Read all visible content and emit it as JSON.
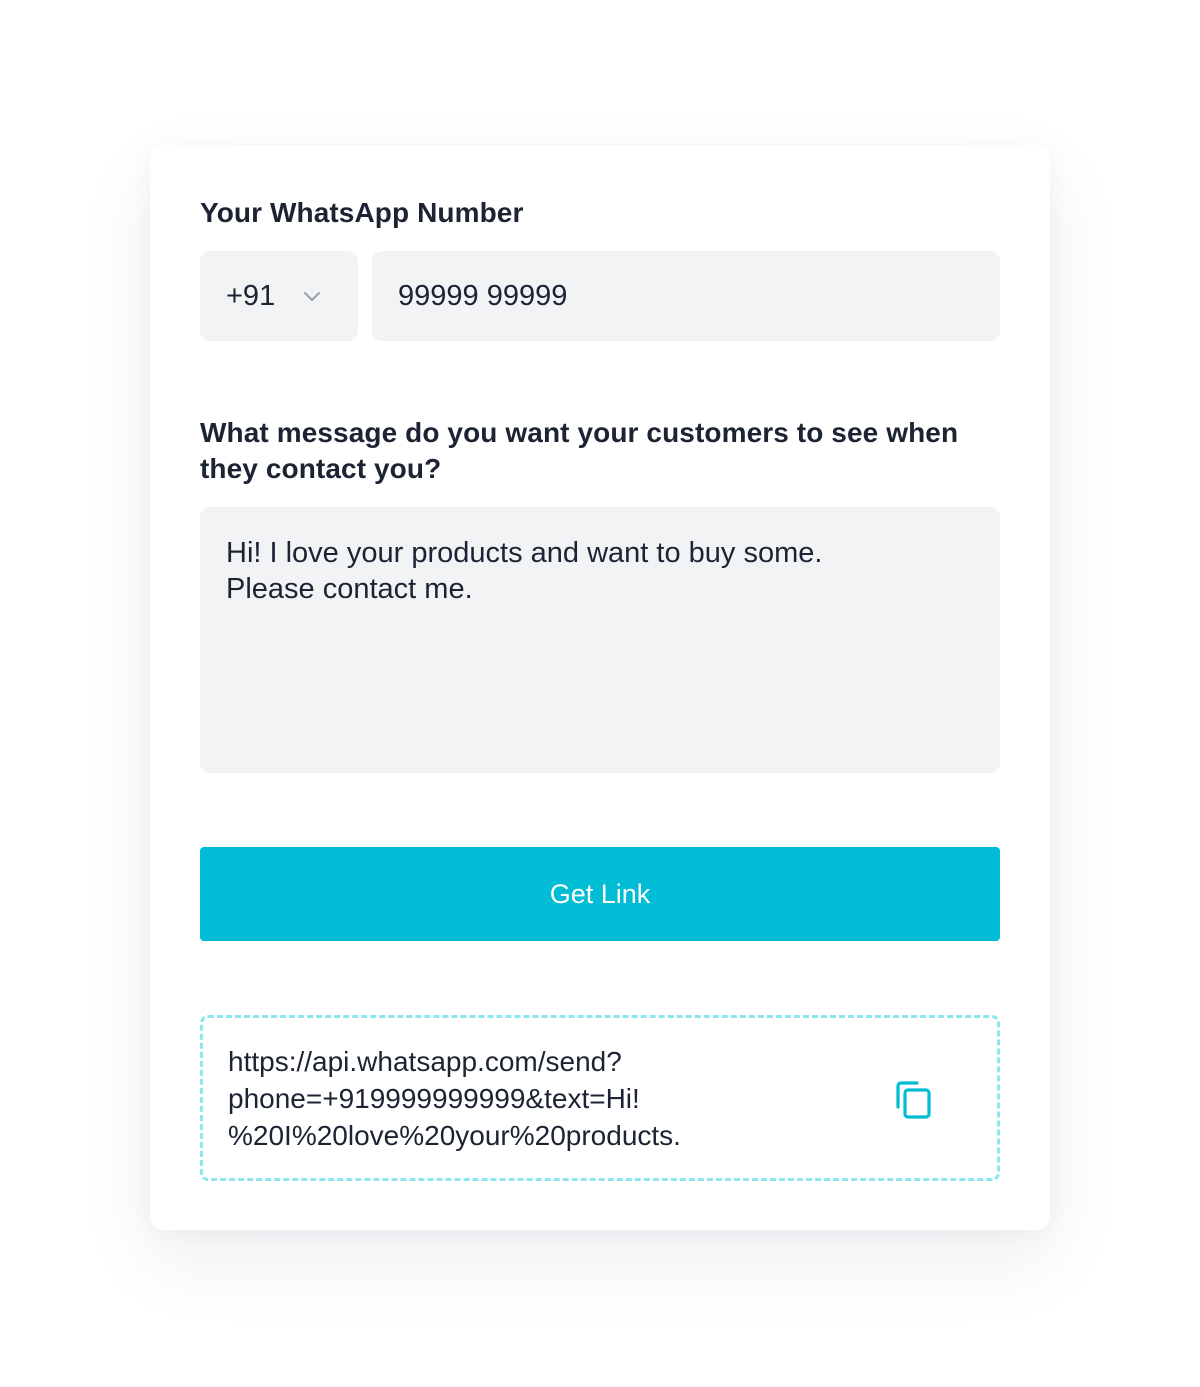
{
  "form": {
    "number_label": "Your WhatsApp Number",
    "country_code": "+91",
    "phone_value": "99999 99999",
    "message_label": "What message do you want your customers to see when they contact you?",
    "message_value": "Hi! I love your products and want to buy some.\nPlease contact me.",
    "submit_label": "Get Link"
  },
  "result": {
    "link_text": "https://api.whatsapp.com/send?\nphone=+919999999999&text=Hi!\n%20I%20love%20your%20products."
  },
  "icons": {
    "dropdown": "chevron-down-icon",
    "copy": "copy-icon"
  },
  "colors": {
    "accent": "#00bcd4",
    "field_bg": "#f2f3f5",
    "text": "#1c2433",
    "dashed_border": "#8ce6ee"
  }
}
